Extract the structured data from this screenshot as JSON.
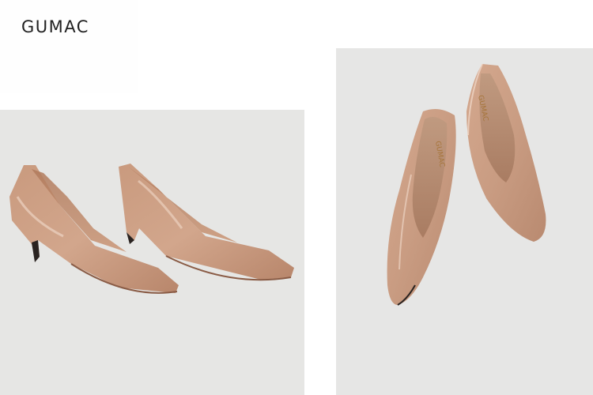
{
  "brand": {
    "logo_text": "GUMAC"
  },
  "photos": [
    {
      "subject": "pair-of-nude-patent-pointed-pumps-side-view"
    },
    {
      "subject": "pair-of-nude-patent-pointed-pumps-top-view",
      "insole_brand": "GUMAC"
    }
  ],
  "colors": {
    "shoe": "#c89a80",
    "background": "#e6e6e4"
  }
}
